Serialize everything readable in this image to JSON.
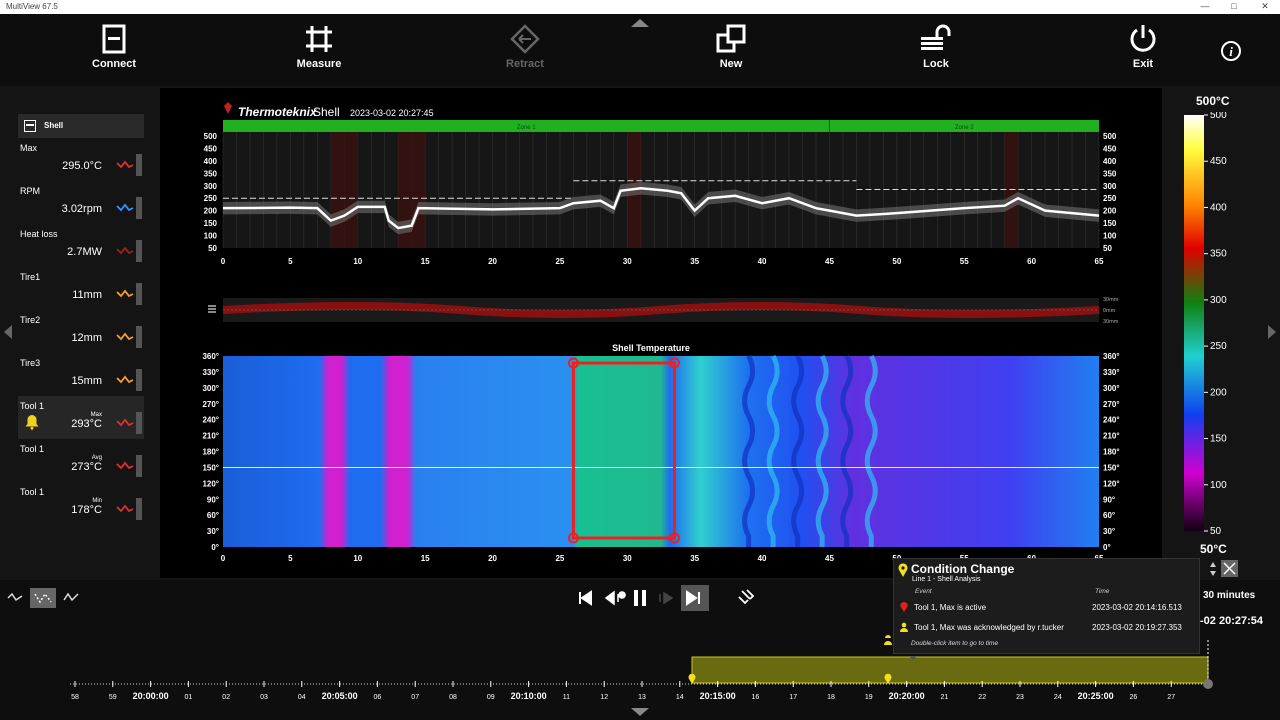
{
  "window": {
    "title": "MultiView 67.5"
  },
  "toolbar": {
    "connect": "Connect",
    "measure": "Measure",
    "retract": "Retract",
    "new": "New",
    "lock": "Lock",
    "exit": "Exit"
  },
  "sidebar": {
    "header": "Shell",
    "items": [
      {
        "label": "Max",
        "value": "295.0°C",
        "color": "#e03030"
      },
      {
        "label": "RPM",
        "value": "3.02rpm",
        "color": "#3a8fff"
      },
      {
        "label": "Heat loss",
        "value": "2.7MW",
        "color": "#a02020"
      },
      {
        "label": "Tire1",
        "value": "11mm",
        "color": "#f0a030"
      },
      {
        "label": "Tire2",
        "value": "12mm",
        "color": "#f0a030"
      },
      {
        "label": "Tire3",
        "value": "15mm",
        "color": "#f0a030"
      },
      {
        "label": "Tool 1",
        "sub": "Max",
        "value": "293°C",
        "color": "#e03030",
        "alarm": true
      },
      {
        "label": "Tool 1",
        "sub": "Avg",
        "value": "273°C",
        "color": "#e03030"
      },
      {
        "label": "Tool 1",
        "sub": "Min",
        "value": "178°C",
        "color": "#e03030"
      }
    ]
  },
  "profile": {
    "brand": "Thermoteknix",
    "product": "Shell",
    "timestamp": "2023-03-02 20:27:45",
    "zone1": "Zone 1",
    "zone2": "Zone 2",
    "y_ticks": [
      "500",
      "450",
      "400",
      "350",
      "300",
      "250",
      "200",
      "150",
      "100",
      "50"
    ],
    "x_ticks": [
      "0",
      "5",
      "10",
      "15",
      "20",
      "25",
      "30",
      "35",
      "40",
      "45",
      "50",
      "55",
      "60",
      "65"
    ]
  },
  "tires": {
    "ticks": [
      "30mm",
      "0mm",
      "30mm"
    ]
  },
  "thermal": {
    "title": "Shell Temperature",
    "y_ticks": [
      "360°",
      "330°",
      "300°",
      "270°",
      "240°",
      "210°",
      "180°",
      "150°",
      "120°",
      "90°",
      "60°",
      "30°",
      "0°"
    ],
    "x_ticks": [
      "0",
      "5",
      "10",
      "15",
      "20",
      "25",
      "30",
      "35",
      "40",
      "45",
      "50",
      "55",
      "60",
      "65"
    ]
  },
  "colorscale": {
    "max_label": "500°C",
    "min_label": "50°C",
    "ticks": [
      "500",
      "450",
      "400",
      "350",
      "300",
      "250",
      "200",
      "150",
      "100",
      "50"
    ]
  },
  "popup": {
    "title": "Condition Change",
    "subtitle": "Line 1 - Shell Analysis",
    "col_event": "Event",
    "col_time": "Time",
    "rows": [
      {
        "text": "Tool 1, Max is active",
        "time": "2023-03-02 20:14:16.513",
        "icon": "red-pin"
      },
      {
        "text": "Tool 1, Max was acknowledged by r.tucker",
        "time": "2023-03-02 20:19:27.353",
        "icon": "yellow-user"
      }
    ],
    "note": "Double-click item to go to time"
  },
  "timeline": {
    "duration": "30 minutes",
    "current_time": "-02 20:27:54",
    "labels": [
      "58",
      "59",
      "20:00:00",
      "01",
      "02",
      "03",
      "04",
      "20:05:00",
      "06",
      "07",
      "08",
      "09",
      "20:10:00",
      "11",
      "12",
      "13",
      "14",
      "20:15:00",
      "16",
      "17",
      "18",
      "19",
      "20:20:00",
      "21",
      "22",
      "23",
      "24",
      "20:25:00",
      "26",
      "27"
    ]
  }
}
